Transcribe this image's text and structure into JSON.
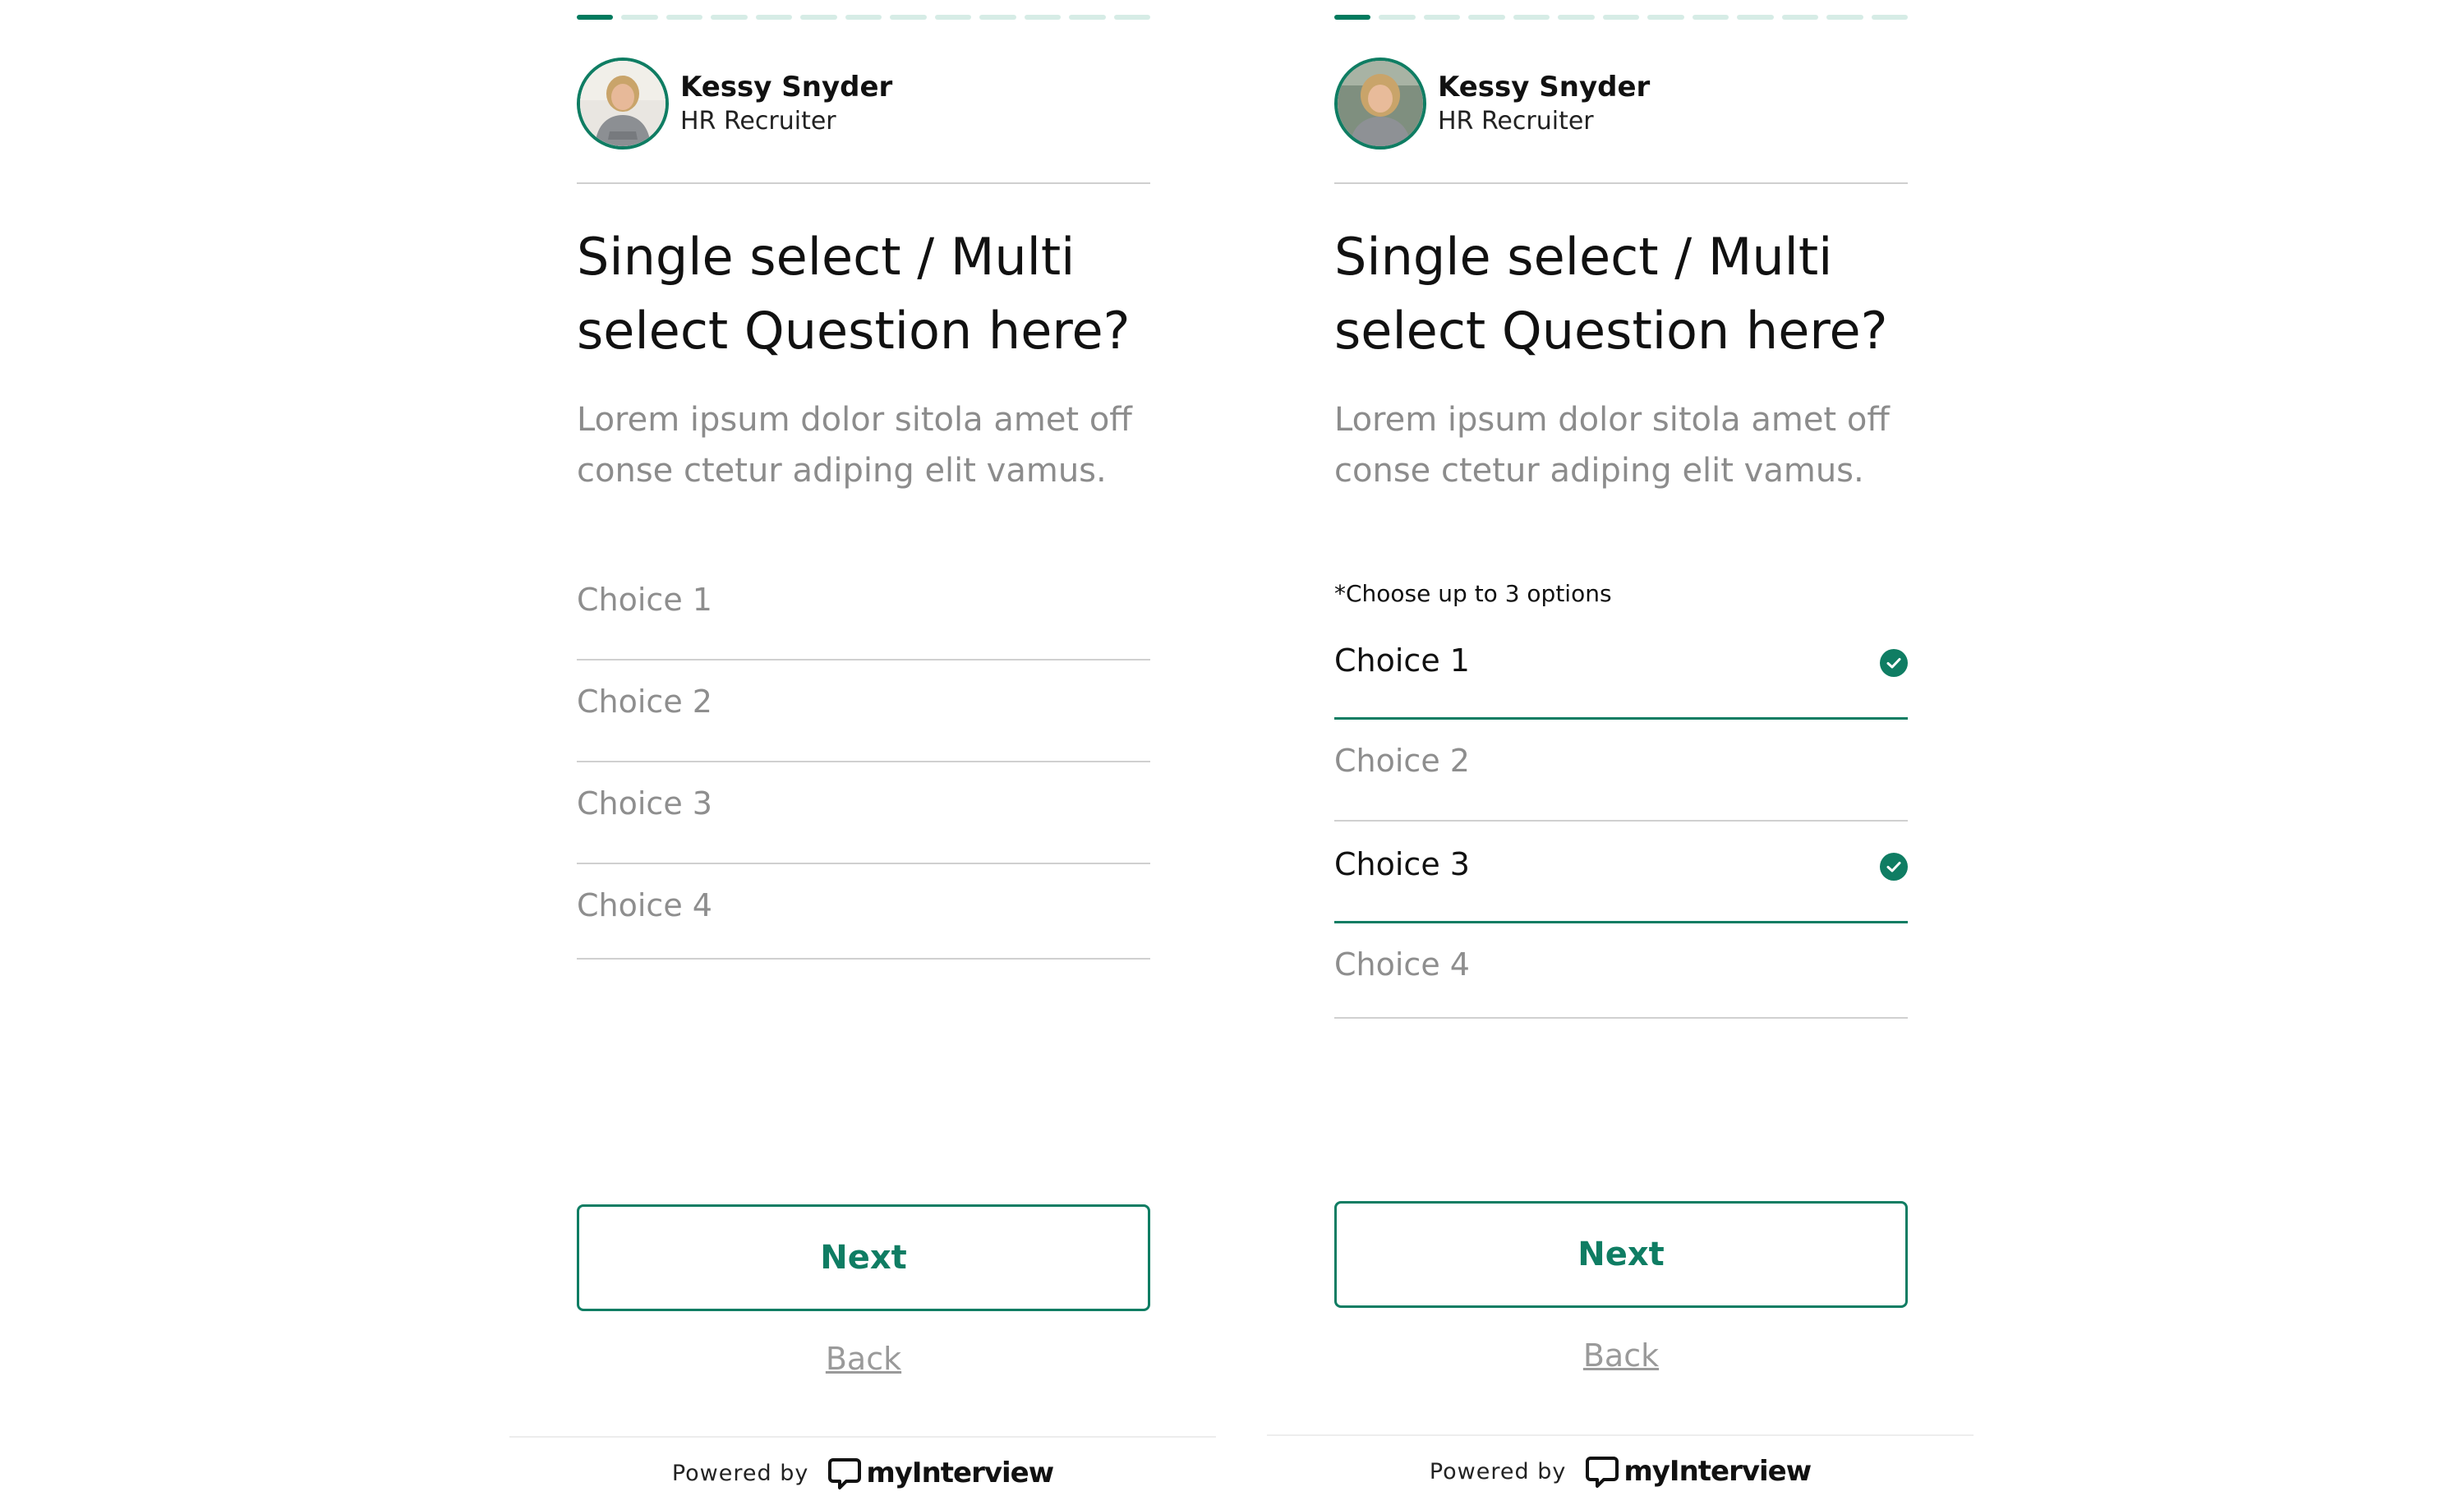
{
  "colors": {
    "accent": "#0f7d63",
    "progress_active": "#007a5e",
    "progress_inactive": "#d6ece6",
    "muted_text": "#8c8c8c",
    "divider": "#d0d0d0"
  },
  "panels": [
    {
      "variant": "single-select",
      "progress": {
        "total_steps": 13,
        "current_step": 1
      },
      "recruiter": {
        "name": "Kessy Snyder",
        "role": "HR Recruiter",
        "avatar_icon": "person-photo-icon"
      },
      "question": "Single select / Multi select Question here?",
      "description": "Lorem ipsum dolor sitola amet off conse ctetur adiping elit vamus.",
      "hint": "",
      "choices": [
        {
          "label": "Choice 1",
          "selected": false
        },
        {
          "label": "Choice 2",
          "selected": false
        },
        {
          "label": "Choice 3",
          "selected": false
        },
        {
          "label": "Choice 4",
          "selected": false
        }
      ],
      "next_label": "Next",
      "back_label": "Back",
      "footer": {
        "powered_by": "Powered by",
        "brand": "myInterview",
        "brand_icon": "speech-bubble-icon"
      }
    },
    {
      "variant": "multi-select",
      "progress": {
        "total_steps": 13,
        "current_step": 1
      },
      "recruiter": {
        "name": "Kessy Snyder",
        "role": "HR Recruiter",
        "avatar_icon": "person-photo-icon"
      },
      "question": "Single select / Multi select Question here?",
      "description": "Lorem ipsum dolor sitola amet off conse ctetur adiping elit vamus.",
      "hint": "*Choose up to 3 options",
      "choices": [
        {
          "label": "Choice 1",
          "selected": true,
          "icon": "check-circle-icon"
        },
        {
          "label": "Choice 2",
          "selected": false
        },
        {
          "label": "Choice 3",
          "selected": true,
          "icon": "check-circle-icon"
        },
        {
          "label": "Choice 4",
          "selected": false
        }
      ],
      "next_label": "Next",
      "back_label": "Back",
      "footer": {
        "powered_by": "Powered by",
        "brand": "myInterview",
        "brand_icon": "speech-bubble-icon"
      }
    }
  ]
}
